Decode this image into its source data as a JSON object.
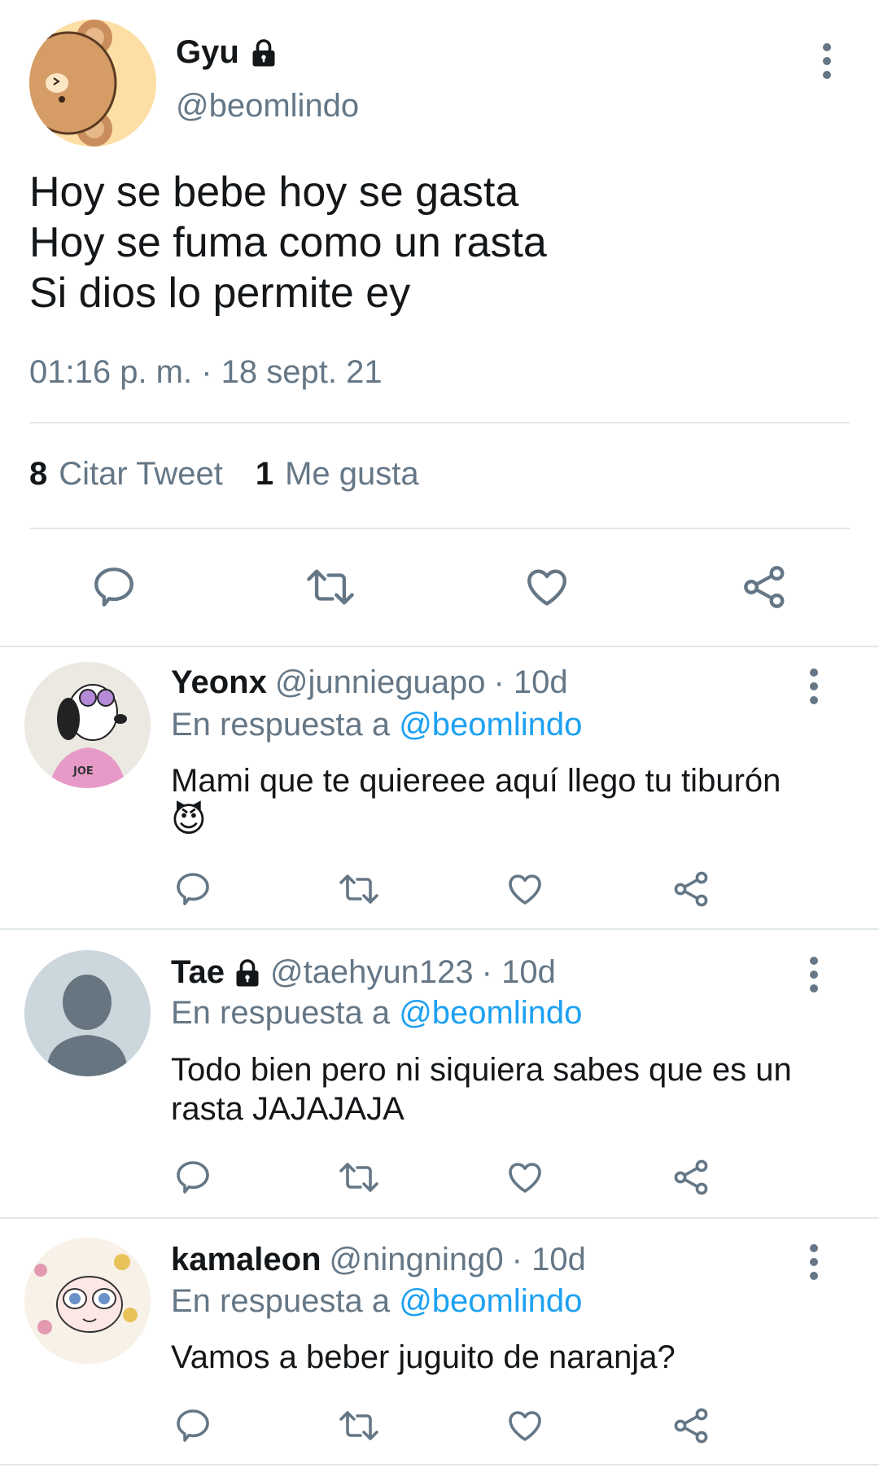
{
  "tweet": {
    "author_name": "Gyu",
    "author_handle": "@beomlindo",
    "text": "Hoy se bebe hoy se gasta\nHoy se fuma como un rasta\nSi dios lo permite ey",
    "timestamp": "01:16 p. m. · 18 sept. 21",
    "quote_count": "8",
    "quote_label": "Citar Tweet",
    "like_count": "1",
    "like_label": "Me gusta"
  },
  "replies": [
    {
      "name": "Yeonx",
      "handle": "@junnieguapo",
      "time": "· 10d",
      "reply_prefix": "En respuesta a",
      "reply_to": "@beomlindo",
      "text": "Mami que te quiereee aquí llego tu tiburón",
      "emoji": "😈",
      "locked": false
    },
    {
      "name": "Tae",
      "handle": "@taehyun123",
      "time": "· 10d",
      "reply_prefix": "En respuesta a",
      "reply_to": "@beomlindo",
      "text": "Todo bien pero ni siquiera sabes que es un rasta JAJAJAJA",
      "locked": true
    },
    {
      "name": "kamaleon",
      "handle": "@ningning0",
      "time": "· 10d",
      "reply_prefix": "En respuesta a",
      "reply_to": "@beomlindo",
      "text": "Vamos a beber juguito de naranja?",
      "locked": false
    }
  ],
  "colors": {
    "text": "#14171a",
    "secondary": "#657786",
    "link": "#1da1f2",
    "divider": "#e1e8ed"
  },
  "icons": [
    "lock-icon",
    "more-icon",
    "reply-icon",
    "retweet-icon",
    "like-icon",
    "share-icon"
  ]
}
